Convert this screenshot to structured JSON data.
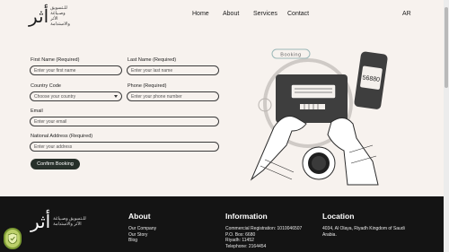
{
  "header": {
    "logo_glyph": "أثر",
    "logo_small_lines": [
      "للـتسويق وصـياغة",
      "الأثر والاستدامة"
    ],
    "nav": [
      "Home",
      "About",
      "Services",
      "Contact"
    ],
    "lang": "AR"
  },
  "form": {
    "first_name": {
      "label": "First Name (Required)",
      "placeholder": "Enter your first name"
    },
    "last_name": {
      "label": "Last Name (Required)",
      "placeholder": "Enter your last name"
    },
    "country_code": {
      "label": "Country Code",
      "value": "Choose your country"
    },
    "phone": {
      "label": "Phone (Required)",
      "placeholder": "Enter your phone number"
    },
    "email": {
      "label": "Email",
      "placeholder": "Enter your email"
    },
    "address": {
      "label": "National Address (Required)",
      "placeholder": "Enter your address"
    },
    "submit_label": "Confirm Booking"
  },
  "illustration": {
    "booking_tag": "Booking",
    "phone_code": "56880"
  },
  "footer": {
    "logo_glyph": "أثر",
    "about": {
      "title": "About",
      "links": [
        "Our Company",
        "Our Story",
        "Blog"
      ]
    },
    "information": {
      "title": "Information",
      "lines": [
        "Commercial Registration: 1010046507",
        "P.O. Box: 6680",
        "Riyadh: 11452",
        "Telephone: 2164454"
      ]
    },
    "location": {
      "title": "Location",
      "lines": [
        "4034, Al Olaya, Riyadh Kingdom of Saudi",
        "Arabia."
      ]
    }
  },
  "colors": {
    "background": "#f7f2ee",
    "footer": "#141414",
    "button": "#27302a",
    "screen": "#3e3e3e",
    "booking_tag_border": "#9cb8b8"
  }
}
